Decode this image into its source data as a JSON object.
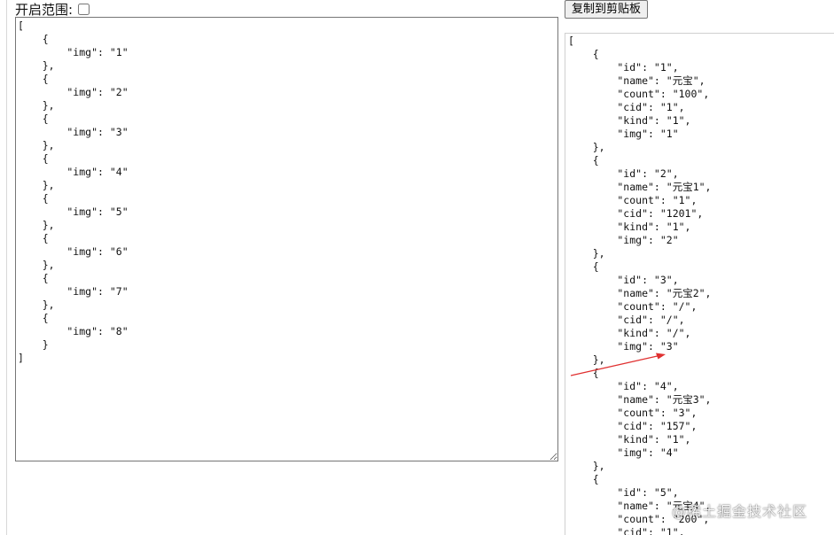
{
  "range_toggle": {
    "label": "开启范围:",
    "checked": false
  },
  "input_editor": {
    "value": "[\n    {\n        \"img\": \"1\"\n    },\n    {\n        \"img\": \"2\"\n    },\n    {\n        \"img\": \"3\"\n    },\n    {\n        \"img\": \"4\"\n    },\n    {\n        \"img\": \"5\"\n    },\n    {\n        \"img\": \"6\"\n    },\n    {\n        \"img\": \"7\"\n    },\n    {\n        \"img\": \"8\"\n    }\n]"
  },
  "toolbar": {
    "copy_label": "复制到剪贴板"
  },
  "output": {
    "text": "[\n    {\n        \"id\": \"1\",\n        \"name\": \"元宝\",\n        \"count\": \"100\",\n        \"cid\": \"1\",\n        \"kind\": \"1\",\n        \"img\": \"1\"\n    },\n    {\n        \"id\": \"2\",\n        \"name\": \"元宝1\",\n        \"count\": \"1\",\n        \"cid\": \"1201\",\n        \"kind\": \"1\",\n        \"img\": \"2\"\n    },\n    {\n        \"id\": \"3\",\n        \"name\": \"元宝2\",\n        \"count\": \"/\",\n        \"cid\": \"/\",\n        \"kind\": \"/\",\n        \"img\": \"3\"\n    },\n    {\n        \"id\": \"4\",\n        \"name\": \"元宝3\",\n        \"count\": \"3\",\n        \"cid\": \"157\",\n        \"kind\": \"1\",\n        \"img\": \"4\"\n    },\n    {\n        \"id\": \"5\",\n        \"name\": \"元宝4\",\n        \"count\": \"200\",\n        \"cid\": \"1\","
  },
  "watermark": {
    "text": "@稀土掘金技术社区"
  },
  "colors": {
    "annotation_arrow": "#e03030"
  }
}
